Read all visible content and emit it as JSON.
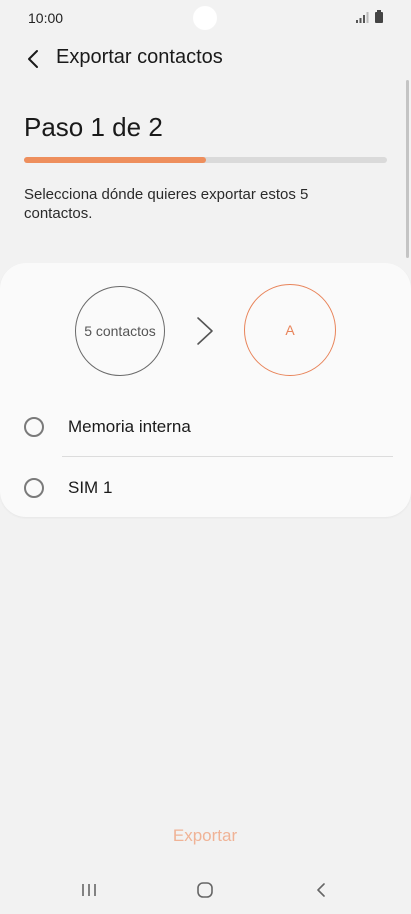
{
  "status_bar": {
    "time": "10:00"
  },
  "header": {
    "title": "Exportar contactos"
  },
  "step": {
    "label": "Paso 1 de 2",
    "progress_percent": 50
  },
  "instruction": "Selecciona dónde quieres exportar estos 5 contactos.",
  "transfer": {
    "source_label": "5 contactos",
    "destination_label": "A"
  },
  "options": [
    {
      "label": "Memoria interna",
      "selected": false
    },
    {
      "label": "SIM 1",
      "selected": false
    }
  ],
  "footer": {
    "export_label": "Exportar"
  },
  "colors": {
    "accent": "#ee8f5d",
    "accent_disabled": "#f0b396"
  },
  "icons": [
    "back-arrow-icon",
    "signal-icon",
    "battery-icon",
    "chevron-right-icon",
    "recents-icon",
    "home-icon",
    "nav-back-icon"
  ]
}
